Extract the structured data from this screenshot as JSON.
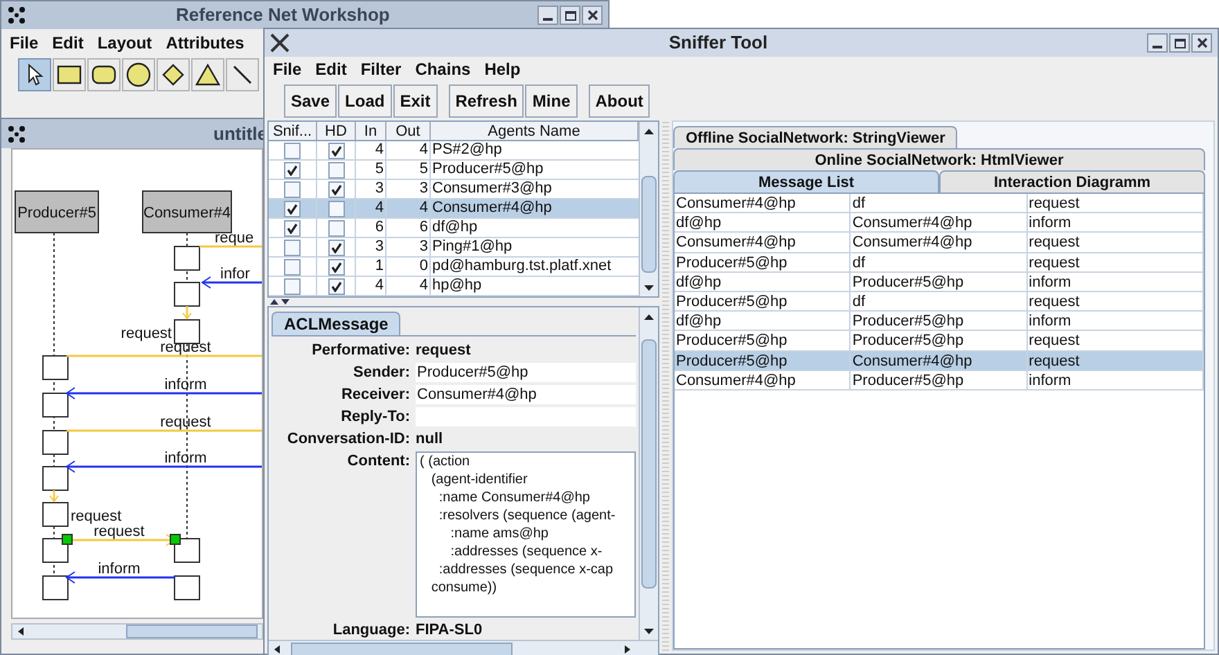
{
  "workshop_window": {
    "title": "Reference Net Workshop",
    "menu": [
      "File",
      "Edit",
      "Layout",
      "Attributes"
    ],
    "tools": [
      {
        "kind": "pointer",
        "selected": true
      },
      {
        "kind": "rectangle",
        "selected": false
      },
      {
        "kind": "rounded",
        "selected": false
      },
      {
        "kind": "ellipse",
        "selected": false
      },
      {
        "kind": "diamond",
        "selected": false
      },
      {
        "kind": "triangle",
        "selected": false
      },
      {
        "kind": "line",
        "selected": false
      }
    ]
  },
  "diagram_window": {
    "title": "untitle",
    "lifelines": [
      "Producer#5",
      "Consumer#4"
    ],
    "messages": [
      {
        "label": "reque",
        "kind": "request"
      },
      {
        "label": "infor",
        "kind": "inform"
      },
      {
        "label": "request",
        "kind": "request"
      },
      {
        "label": "request",
        "kind": "request"
      },
      {
        "label": "inform",
        "kind": "inform"
      },
      {
        "label": "request",
        "kind": "request"
      },
      {
        "label": "inform",
        "kind": "inform"
      },
      {
        "label": "request",
        "kind": "request"
      },
      {
        "label": "request",
        "kind": "request"
      },
      {
        "label": "inform",
        "kind": "inform"
      }
    ]
  },
  "sniffer": {
    "title": "Sniffer Tool",
    "menu": [
      "File",
      "Edit",
      "Filter",
      "Chains",
      "Help"
    ],
    "toolbar": [
      [
        "Save",
        "Load",
        "Exit"
      ],
      [
        "Refresh",
        "Mine"
      ],
      [
        "About"
      ]
    ],
    "agents": {
      "columns": [
        "Snif...",
        "HD",
        "In",
        "Out",
        "Agents Name"
      ],
      "rows": [
        {
          "sniffed": false,
          "hidden": true,
          "in": "4",
          "out": "4",
          "name": "PS#2@hp",
          "selected": false
        },
        {
          "sniffed": true,
          "hidden": false,
          "in": "5",
          "out": "5",
          "name": "Producer#5@hp",
          "selected": false
        },
        {
          "sniffed": false,
          "hidden": true,
          "in": "3",
          "out": "3",
          "name": "Consumer#3@hp",
          "selected": false
        },
        {
          "sniffed": true,
          "hidden": false,
          "in": "4",
          "out": "4",
          "name": "Consumer#4@hp",
          "selected": true
        },
        {
          "sniffed": true,
          "hidden": false,
          "in": "6",
          "out": "6",
          "name": "df@hp",
          "selected": false
        },
        {
          "sniffed": false,
          "hidden": true,
          "in": "3",
          "out": "3",
          "name": "Ping#1@hp",
          "selected": false
        },
        {
          "sniffed": false,
          "hidden": true,
          "in": "1",
          "out": "0",
          "name": "pd@hamburg.tst.platf.xnet",
          "selected": false
        },
        {
          "sniffed": false,
          "hidden": true,
          "in": "4",
          "out": "4",
          "name": "hp@hp",
          "selected": false
        }
      ]
    },
    "acl_tab": "ACLMessage",
    "acl_fields": [
      {
        "label": "Performative:",
        "value": "request",
        "kind": "text"
      },
      {
        "label": "Sender:",
        "value": "Producer#5@hp",
        "kind": "field"
      },
      {
        "label": "Receiver:",
        "value": "Consumer#4@hp",
        "kind": "field"
      },
      {
        "label": "Reply-To:",
        "kind": "field"
      },
      {
        "label": "Conversation-ID:",
        "value": "null",
        "kind": "text"
      },
      {
        "label": "Content:",
        "lines": [
          "( (action",
          "   (agent-identifier",
          "     :name Consumer#4@hp",
          "     :resolvers (sequence (agent-",
          "        :name ams@hp",
          "        :addresses (sequence x-",
          "     :addresses (sequence x-cap",
          "   consume))"
        ],
        "kind": "area"
      },
      {
        "label": "Language:",
        "value": "FIPA-SL0",
        "kind": "text"
      }
    ],
    "viewer_tabs": [
      [
        {
          "label": "Offline SocialNetwork: StringViewer",
          "selected": false
        }
      ],
      [
        {
          "label": "Online SocialNetwork: HtmlViewer",
          "selected": false
        }
      ],
      [
        {
          "label": "Message List",
          "selected": true
        },
        {
          "label": "Interaction Diagramm",
          "selected": false
        }
      ]
    ],
    "messages": [
      {
        "cells": [
          "Consumer#4@hp",
          "df",
          "request"
        ],
        "selected": false
      },
      {
        "cells": [
          "df@hp",
          "Consumer#4@hp",
          "inform"
        ],
        "selected": false
      },
      {
        "cells": [
          "Consumer#4@hp",
          "Consumer#4@hp",
          "request"
        ],
        "selected": false
      },
      {
        "cells": [
          "Producer#5@hp",
          "df",
          "request"
        ],
        "selected": false
      },
      {
        "cells": [
          "df@hp",
          "Producer#5@hp",
          "inform"
        ],
        "selected": false
      },
      {
        "cells": [
          "Producer#5@hp",
          "df",
          "request"
        ],
        "selected": false
      },
      {
        "cells": [
          "df@hp",
          "Producer#5@hp",
          "inform"
        ],
        "selected": false
      },
      {
        "cells": [
          "Producer#5@hp",
          "Producer#5@hp",
          "request"
        ],
        "selected": false
      },
      {
        "cells": [
          "Producer#5@hp",
          "Consumer#4@hp",
          "request"
        ],
        "selected": true
      },
      {
        "cells": [
          "Consumer#4@hp",
          "Producer#5@hp",
          "inform"
        ],
        "selected": false
      }
    ]
  }
}
